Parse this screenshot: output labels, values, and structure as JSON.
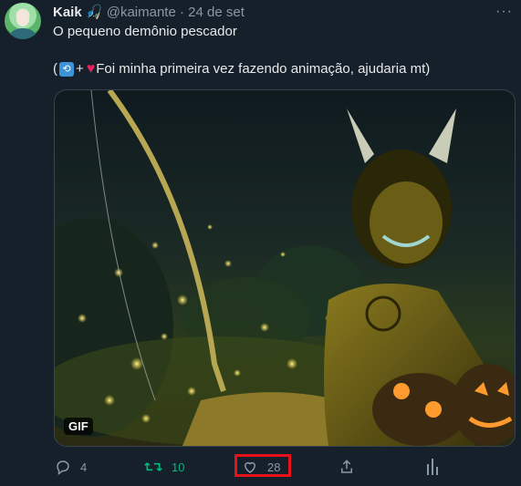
{
  "tweet": {
    "author_name": "Kaik",
    "author_badge_icon": "fishing-emoji",
    "handle": "@kaimante",
    "separator": "·",
    "date": "24 de set",
    "more_icon": "···",
    "text_line1": "O pequeno demônio pescador",
    "text_open": "(",
    "retweet_emoji": "🔁",
    "plus": "+",
    "text_line2": "Foi minha primeira vez fazendo animação, ajudaria mt)",
    "media_badge": "GIF"
  },
  "actions": {
    "reply_count": "4",
    "retweet_count": "10",
    "like_count": "28"
  },
  "colors": {
    "background": "#15202b",
    "text": "#e7e9ea",
    "muted": "#8b98a5",
    "retweet_green": "#00ba7c",
    "highlight_red": "#e8101a"
  }
}
